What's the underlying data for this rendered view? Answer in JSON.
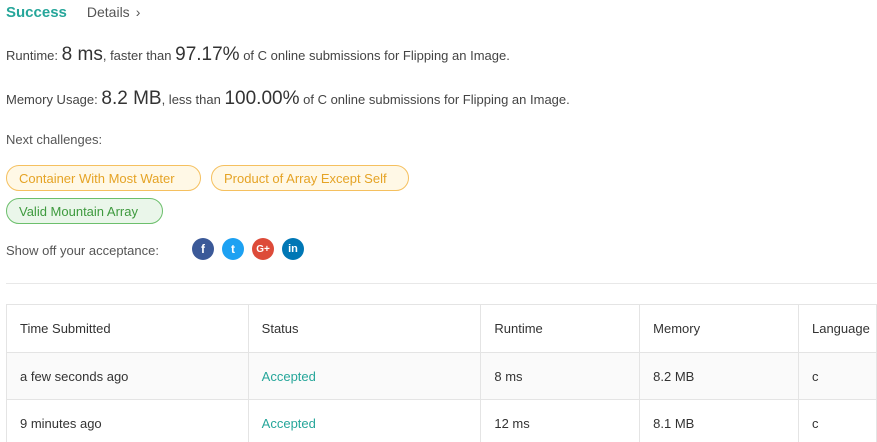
{
  "header": {
    "status": "Success",
    "details_label": "Details",
    "details_chevron": "›"
  },
  "runtime": {
    "label": "Runtime:",
    "value": "8 ms",
    "mid": ", faster than",
    "percent": "97.17%",
    "suffix": "of C online submissions for Flipping an Image."
  },
  "memory": {
    "label": "Memory Usage:",
    "value": "8.2 MB",
    "mid": ", less than",
    "percent": "100.00%",
    "suffix": "of C online submissions for Flipping an Image."
  },
  "next_challenges": {
    "label": "Next challenges:",
    "items": [
      {
        "title": "Container With Most Water",
        "difficulty": "medium"
      },
      {
        "title": "Product of Array Except Self",
        "difficulty": "medium"
      },
      {
        "title": "Valid Mountain Array",
        "difficulty": "easy"
      }
    ]
  },
  "share": {
    "label": "Show off your acceptance:",
    "icons": [
      "facebook-icon",
      "twitter-icon",
      "google-plus-icon",
      "linkedin-icon"
    ],
    "glyphs": {
      "facebook": "f",
      "twitter": "t",
      "google_plus": "G+",
      "linkedin": "in"
    }
  },
  "submissions": {
    "columns": [
      "Time Submitted",
      "Status",
      "Runtime",
      "Memory",
      "Language"
    ],
    "rows": [
      {
        "time": "a few seconds ago",
        "status": "Accepted",
        "runtime": "8 ms",
        "memory": "8.2 MB",
        "language": "c"
      },
      {
        "time": "9 minutes ago",
        "status": "Accepted",
        "runtime": "12 ms",
        "memory": "8.1 MB",
        "language": "c"
      }
    ]
  },
  "colors": {
    "accent": "#26a69a",
    "medium": "#e5a325",
    "easy": "#3e9a3e"
  }
}
